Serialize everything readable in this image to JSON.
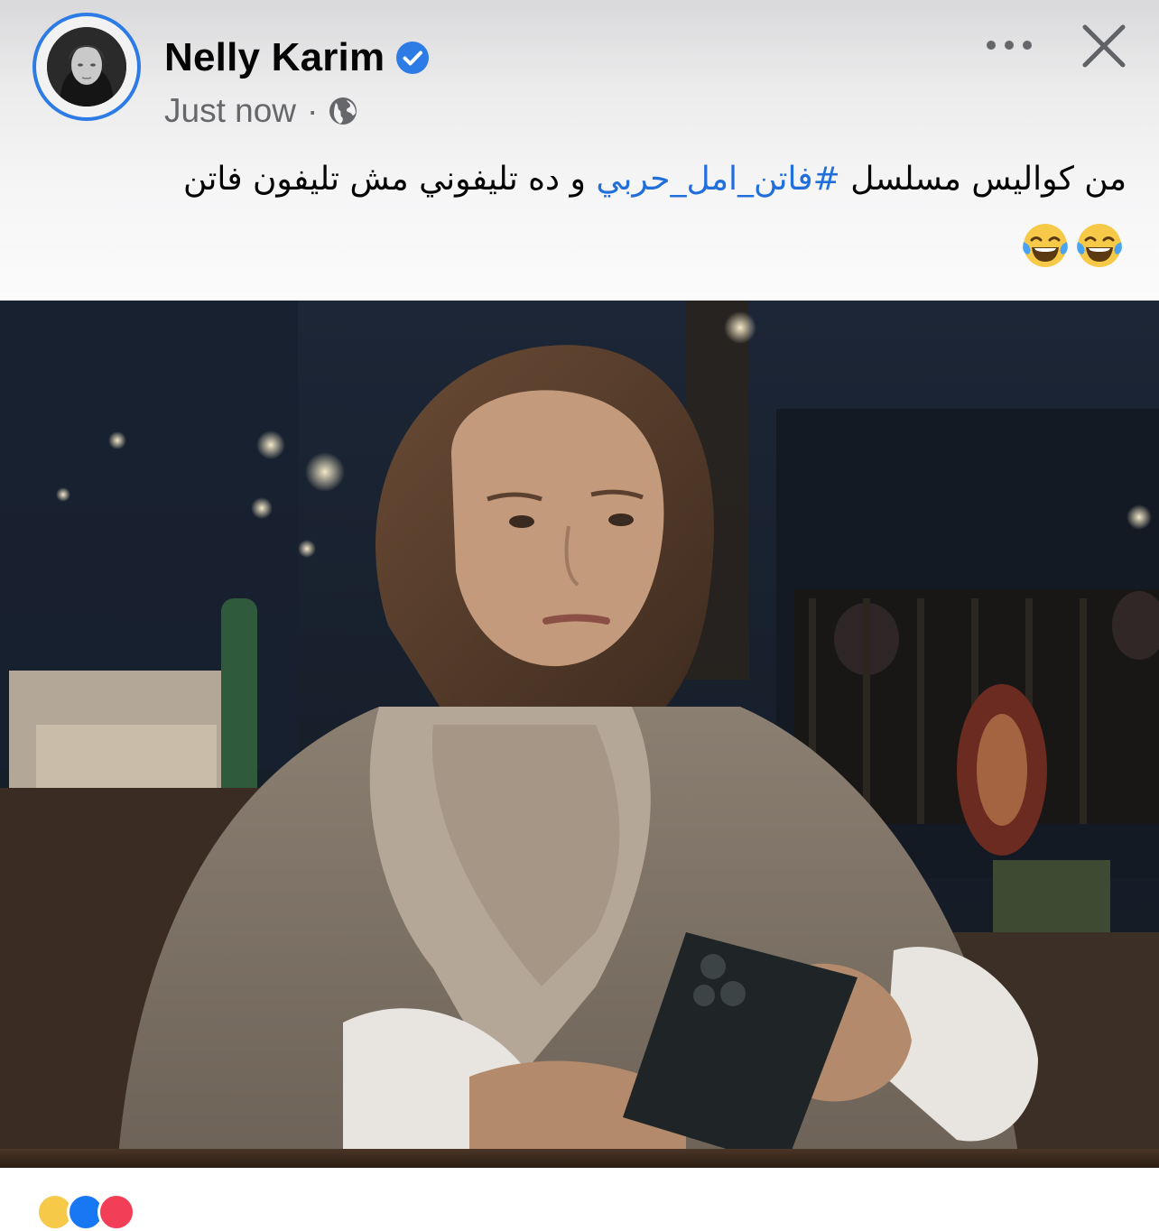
{
  "post": {
    "author_name": "Nelly Karim",
    "verified": true,
    "timestamp": "Just now",
    "separator": "·",
    "audience_icon": "globe-icon",
    "caption_pre": "من كواليس مسلسل ",
    "hashtag": "#فاتن_امل_حربي",
    "caption_post": " و ده تليفوني مش تليفون فاتن",
    "emojis": [
      "😂",
      "😂"
    ],
    "more_icon": "more-horizontal-icon",
    "close_icon": "close-icon"
  },
  "colors": {
    "accent": "#2d7be5",
    "hashtag": "#216fdb",
    "text_primary": "#050505",
    "text_secondary": "#65676b"
  },
  "reactions": {
    "icons": [
      "haha-reaction-icon",
      "like-reaction-icon",
      "love-reaction-icon"
    ]
  }
}
